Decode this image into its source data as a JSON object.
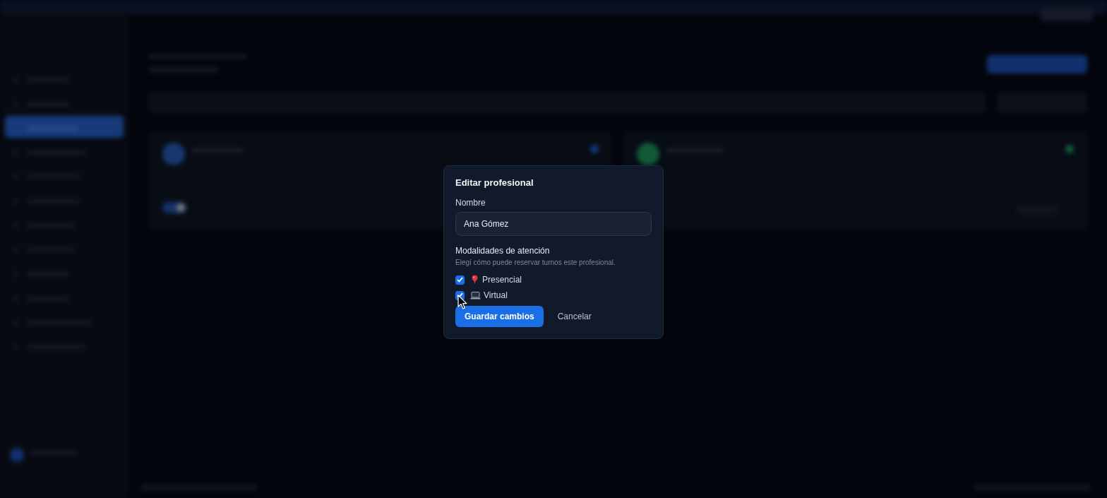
{
  "dialog": {
    "title": "Editar profesional",
    "name_field": {
      "label": "Nombre",
      "value": "Ana Gómez"
    },
    "modalities": {
      "label": "Modalidades de atención",
      "hint": "Elegí cómo puede reservar turnos este profesional.",
      "options": [
        {
          "kind": "pin",
          "label": "Presencial",
          "checked": true
        },
        {
          "kind": "laptop",
          "label": "Virtual",
          "checked": true
        }
      ]
    },
    "buttons": [
      {
        "kind": "primary",
        "label": "Guardar cambios"
      },
      {
        "kind": "link",
        "label": "Cancelar"
      }
    ]
  }
}
